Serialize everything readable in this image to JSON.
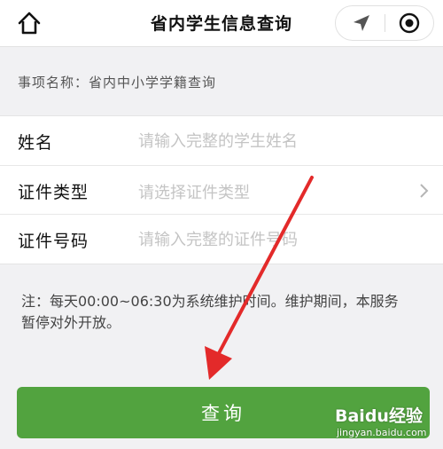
{
  "header": {
    "title": "省内学生信息查询",
    "home_icon": "home-icon",
    "location_icon": "location-arrow-icon",
    "record_icon": "record-circle-icon"
  },
  "item": {
    "label": "事项名称：省内中小学学籍查询"
  },
  "form": {
    "name": {
      "label": "姓名",
      "placeholder": "请输入完整的学生姓名",
      "value": ""
    },
    "id_type": {
      "label": "证件类型",
      "placeholder": "请选择证件类型",
      "icon": "chevron-right-icon"
    },
    "id_number": {
      "label": "证件号码",
      "placeholder": "请输入完整的证件号码",
      "value": ""
    }
  },
  "notice": "注：每天00:00~06:30为系统维护时间。维护期间，本服务暂停对外开放。",
  "query_button": {
    "label": "查询",
    "color": "#52a33f"
  },
  "watermark": {
    "logo": "Baidu经验",
    "url": "jingyan.baidu.com"
  },
  "annotation_color": "#e32a2a"
}
